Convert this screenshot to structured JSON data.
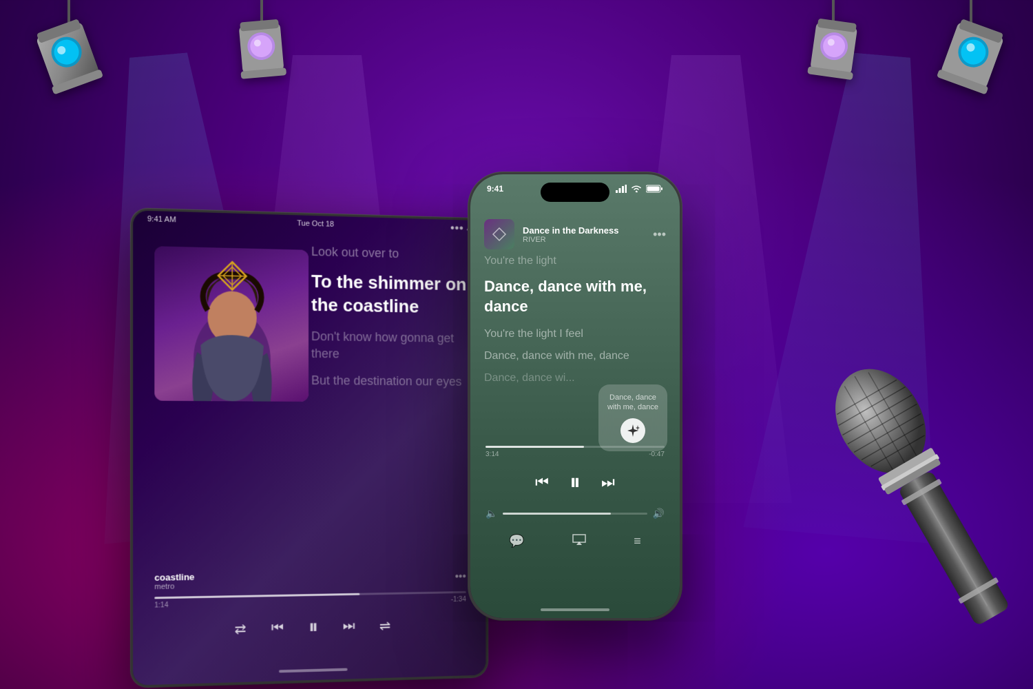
{
  "background": {
    "gradient": "purple to dark purple"
  },
  "spotlights": [
    {
      "id": 1,
      "position": "top-left",
      "color": "#00bfff"
    },
    {
      "id": 2,
      "position": "top-center-left",
      "color": "#cc88ff"
    },
    {
      "id": 3,
      "position": "top-center-right",
      "color": "#cc88ff"
    },
    {
      "id": 4,
      "position": "top-right",
      "color": "#00bfff"
    }
  ],
  "ipad": {
    "status_bar": {
      "time": "9:41 AM",
      "date": "Tue Oct 18"
    },
    "song": {
      "title": "coastline",
      "artist": "metro"
    },
    "lyrics": {
      "inactive_1": "Look out over to",
      "active": "To the shimmer on the coastline",
      "inactive_2": "Don't know how gonna get there",
      "inactive_3": "But the destination our eyes"
    },
    "progress": {
      "current": "1:14",
      "total": "-1:34",
      "fill_percent": 65
    },
    "controls": {
      "shuffle": "⇄",
      "prev": "⏮",
      "play": "⏸",
      "next": "⏭",
      "repeat": "⇌"
    }
  },
  "iphone": {
    "status_bar": {
      "time": "9:41",
      "signal": "●●●●",
      "wifi": "wifi",
      "battery": "battery"
    },
    "song": {
      "title": "Dance in the Darkness",
      "artist": "RIVER"
    },
    "lyrics": {
      "inactive_top": "You're the light",
      "active": "Dance, dance with me, dance",
      "next_1": "You're the light I feel",
      "next_2": "Dance, dance with me, dance",
      "dim": "Dance, dance wi..."
    },
    "bubble": {
      "text": "Dance, dance with me, dance",
      "icon": "✦"
    },
    "progress": {
      "current": "3:14",
      "total": "-0:47",
      "fill_percent": 55
    },
    "volume": {
      "fill_percent": 75
    },
    "bottom_controls": {
      "lyrics": "💬",
      "airplay": "⊚",
      "queue": "≡"
    }
  },
  "microphone": {
    "visible": true,
    "position": "right"
  }
}
